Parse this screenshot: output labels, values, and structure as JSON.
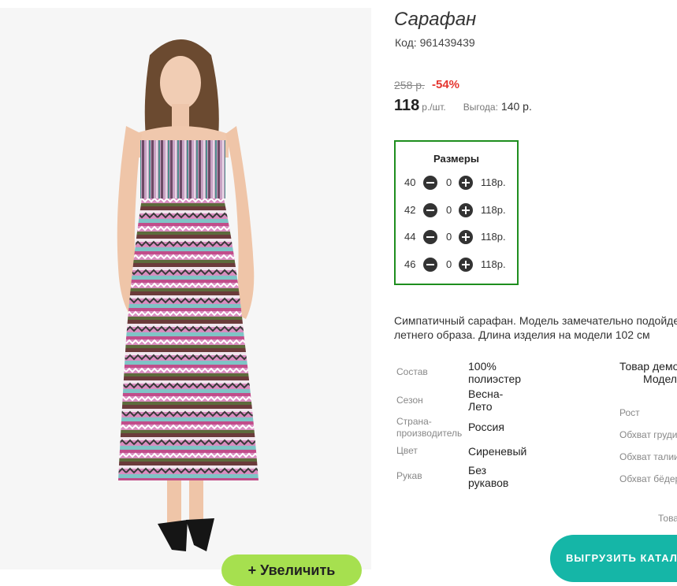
{
  "product": {
    "title": "Сарафан",
    "code": "Код: 961439439",
    "old_price": "258 р.",
    "discount": "-54%",
    "price": "118",
    "price_unit": "р./шт.",
    "savings_label": "Выгода:",
    "savings_value": "140 р.",
    "zoom_label": "+  Увеличить"
  },
  "sizes": {
    "title": "Размеры",
    "rows": [
      {
        "size": "40",
        "qty": "0",
        "price": "118р."
      },
      {
        "size": "42",
        "qty": "0",
        "price": "118р."
      },
      {
        "size": "44",
        "qty": "0",
        "price": "118р."
      },
      {
        "size": "46",
        "qty": "0",
        "price": "118р."
      }
    ]
  },
  "description": "Симпатичный сарафан. Модель замечательно подойдет\nлетнего образа. Длина изделия на модели 102 см",
  "attributes": [
    {
      "label": "Состав",
      "value": "100%\nполиэстер"
    },
    {
      "label": "Сезон",
      "value": "Весна-\nЛето"
    },
    {
      "label": "Страна-\nпроизводитель",
      "value": "Россия"
    },
    {
      "label": "Цвет",
      "value": "Сиреневый"
    },
    {
      "label": "Рукав",
      "value": "Без\nрукавов"
    }
  ],
  "model": {
    "title_line1": "Товар демо",
    "title_line2": "Модел",
    "labels": [
      "Рост",
      "Обхват груди",
      "Обхват талии",
      "Обхват бёдер"
    ],
    "footer": "Това"
  },
  "export_label": "ВЫГРУЗИТЬ КАТАЛОГ",
  "colors": {
    "sizes_border": "#1e8e1e",
    "discount": "#e5352f",
    "zoom_button": "#a6e04f",
    "export_button": "#15b6a7"
  }
}
